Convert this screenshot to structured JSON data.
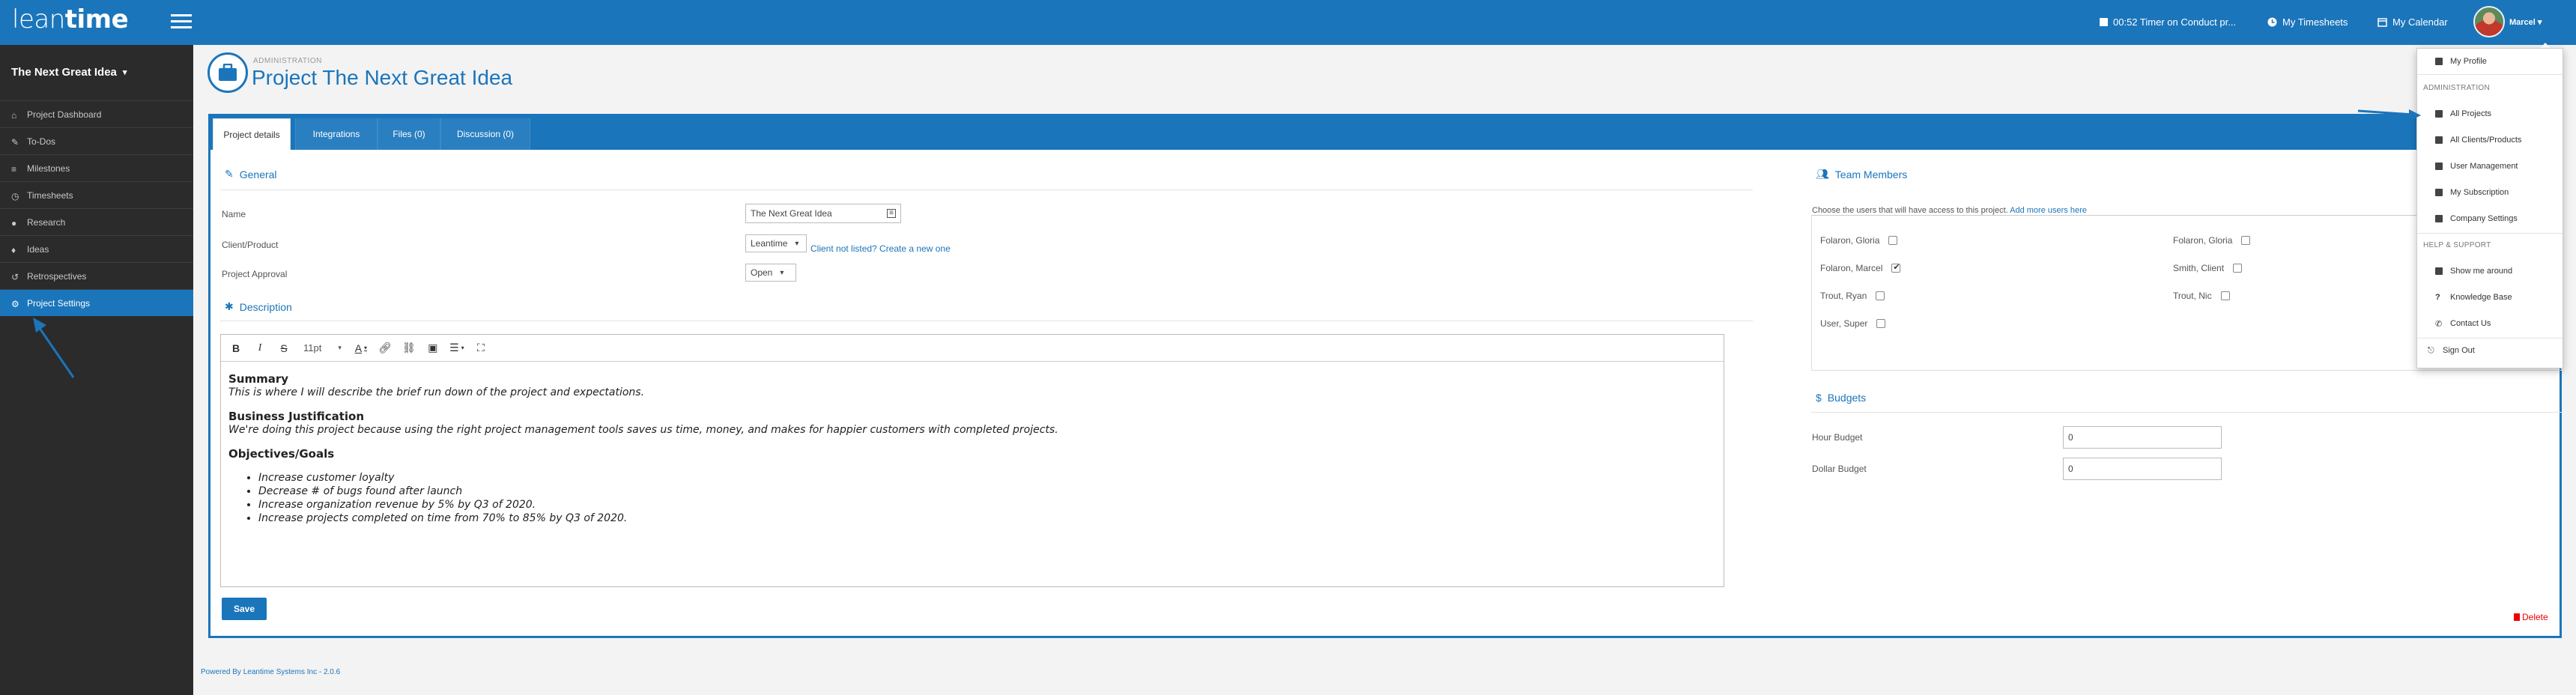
{
  "brand": {
    "logo_light": "lean",
    "logo_bold": "time"
  },
  "header": {
    "timer": "00:52 Timer on Conduct pr...",
    "timesheets": "My Timesheets",
    "calendar": "My Calendar",
    "user": "Marcel"
  },
  "sidebar": {
    "project": "The Next Great Idea",
    "items": [
      {
        "label": "Project Dashboard",
        "icon": "home-icon"
      },
      {
        "label": "To-Dos",
        "icon": "pin-icon"
      },
      {
        "label": "Milestones",
        "icon": "list-icon"
      },
      {
        "label": "Timesheets",
        "icon": "clock-icon"
      },
      {
        "label": "Research",
        "icon": "person-icon"
      },
      {
        "label": "Ideas",
        "icon": "bulb-icon"
      },
      {
        "label": "Retrospectives",
        "icon": "undo-icon"
      },
      {
        "label": "Project Settings",
        "icon": "gear-icon"
      }
    ]
  },
  "page": {
    "subtitle": "ADMINISTRATION",
    "title": "Project The Next Great Idea"
  },
  "tabs": [
    "Project details",
    "Integrations",
    "Files (0)",
    "Discussion (0)"
  ],
  "general": {
    "title": "General",
    "name_label": "Name",
    "name_value": "The Next Great Idea",
    "client_label": "Client/Product",
    "client_value": "Leantime",
    "client_link": "Client not listed? Create a new one",
    "approval_label": "Project Approval",
    "approval_value": "Open"
  },
  "description": {
    "title": "Description",
    "font_size": "11pt",
    "h1": "Summary",
    "p1": "This is where I will describe the brief run down of the project and expectations.",
    "h2": "Business Justification",
    "p2": "We're doing this project because using the right project management tools saves us time, money, and makes for happier customers with completed projects.",
    "h3": "Objectives/Goals",
    "goals": [
      "Increase customer loyalty",
      "Decrease # of bugs found after launch",
      "Increase organization revenue by 5% by Q3 of 2020.",
      "Increase projects completed on time from 70% to 85% by Q3 of 2020."
    ]
  },
  "team": {
    "title": "Team Members",
    "desc": "Choose the users that will have access to this project.",
    "add_link": "Add more users here",
    "members": [
      {
        "name": "Folaron, Gloria",
        "checked": false
      },
      {
        "name": "Folaron, Gloria",
        "checked": false
      },
      {
        "name": "Folaron, Marcel",
        "checked": true
      },
      {
        "name": "Smith, Client",
        "checked": false
      },
      {
        "name": "Trout, Ryan",
        "checked": false
      },
      {
        "name": "Trout, Nic",
        "checked": false
      },
      {
        "name": "User, Super",
        "checked": false
      }
    ]
  },
  "budgets": {
    "title": "Budgets",
    "hour_label": "Hour Budget",
    "hour_value": "0",
    "dollar_label": "Dollar Budget",
    "dollar_value": "0"
  },
  "actions": {
    "save": "Save",
    "delete": "Delete"
  },
  "footer": "Powered By Leantime Systems Inc - 2.0.6",
  "user_menu": {
    "profile": "My Profile",
    "admin_head": "ADMINISTRATION",
    "all_projects": "All Projects",
    "all_clients": "All Clients/Products",
    "user_mgmt": "User Management",
    "subscription": "My Subscription",
    "company": "Company Settings",
    "help_head": "HELP & SUPPORT",
    "show_around": "Show me around",
    "kb": "Knowledge Base",
    "contact": "Contact Us",
    "signout": "Sign Out"
  },
  "colors": {
    "primary": "#1b75bb",
    "sidebar": "#2b2b2b",
    "danger": "#e00000"
  }
}
